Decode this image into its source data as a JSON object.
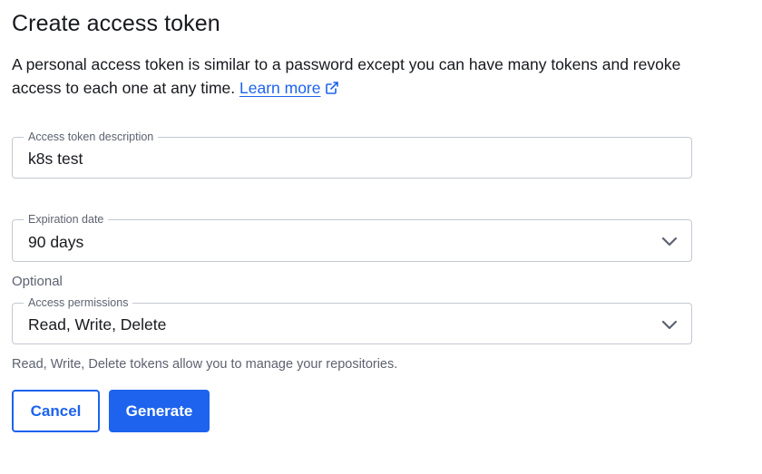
{
  "page": {
    "title": "Create access token",
    "description": "A personal access token is similar to a password except you can have many tokens and revoke access to each one at any time.",
    "learn_more": "Learn more"
  },
  "form": {
    "description_field": {
      "label": "Access token description",
      "value": "k8s test"
    },
    "expiration_field": {
      "label": "Expiration date",
      "value": "90 days"
    },
    "optional_label": "Optional",
    "permissions_field": {
      "label": "Access permissions",
      "value": "Read, Write, Delete"
    },
    "permissions_helper": "Read, Write, Delete tokens allow you to manage your repositories."
  },
  "actions": {
    "cancel": "Cancel",
    "generate": "Generate"
  },
  "icons": {
    "external_link": "external-link-icon",
    "dropdown": "chevron-down-icon"
  },
  "colors": {
    "accent": "#1d63ed",
    "text": "#17191e",
    "muted": "#5d6270",
    "border": "#c4c8d1"
  }
}
